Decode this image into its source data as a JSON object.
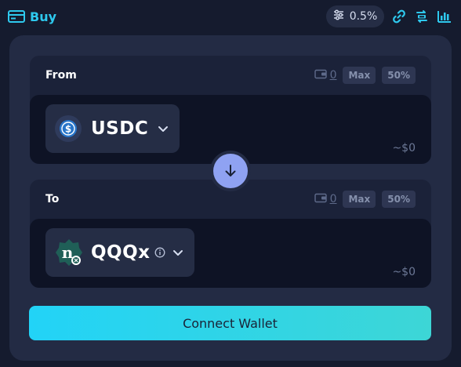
{
  "header": {
    "tab_label": "Buy",
    "tab_icon": "card-icon",
    "slippage_value": "0.5%",
    "slippage_icon": "sliders-icon",
    "icons": [
      "link-icon",
      "refresh-icon",
      "chart-icon"
    ],
    "accent_color": "#2ec9ee"
  },
  "from": {
    "label": "From",
    "balance": "0",
    "max_label": "Max",
    "half_label": "50%",
    "token": "USDC",
    "token_icon": "usdc-icon",
    "usd_value": "~$0"
  },
  "to": {
    "label": "To",
    "balance": "0",
    "max_label": "Max",
    "half_label": "50%",
    "token": "QQQx",
    "token_icon": "qqqx-icon",
    "usd_value": "~$0"
  },
  "swap": {
    "icon": "arrow-down-icon"
  },
  "cta": {
    "label": "Connect Wallet",
    "gradient_start": "#22d3f7",
    "gradient_end": "#3dd6d6"
  }
}
